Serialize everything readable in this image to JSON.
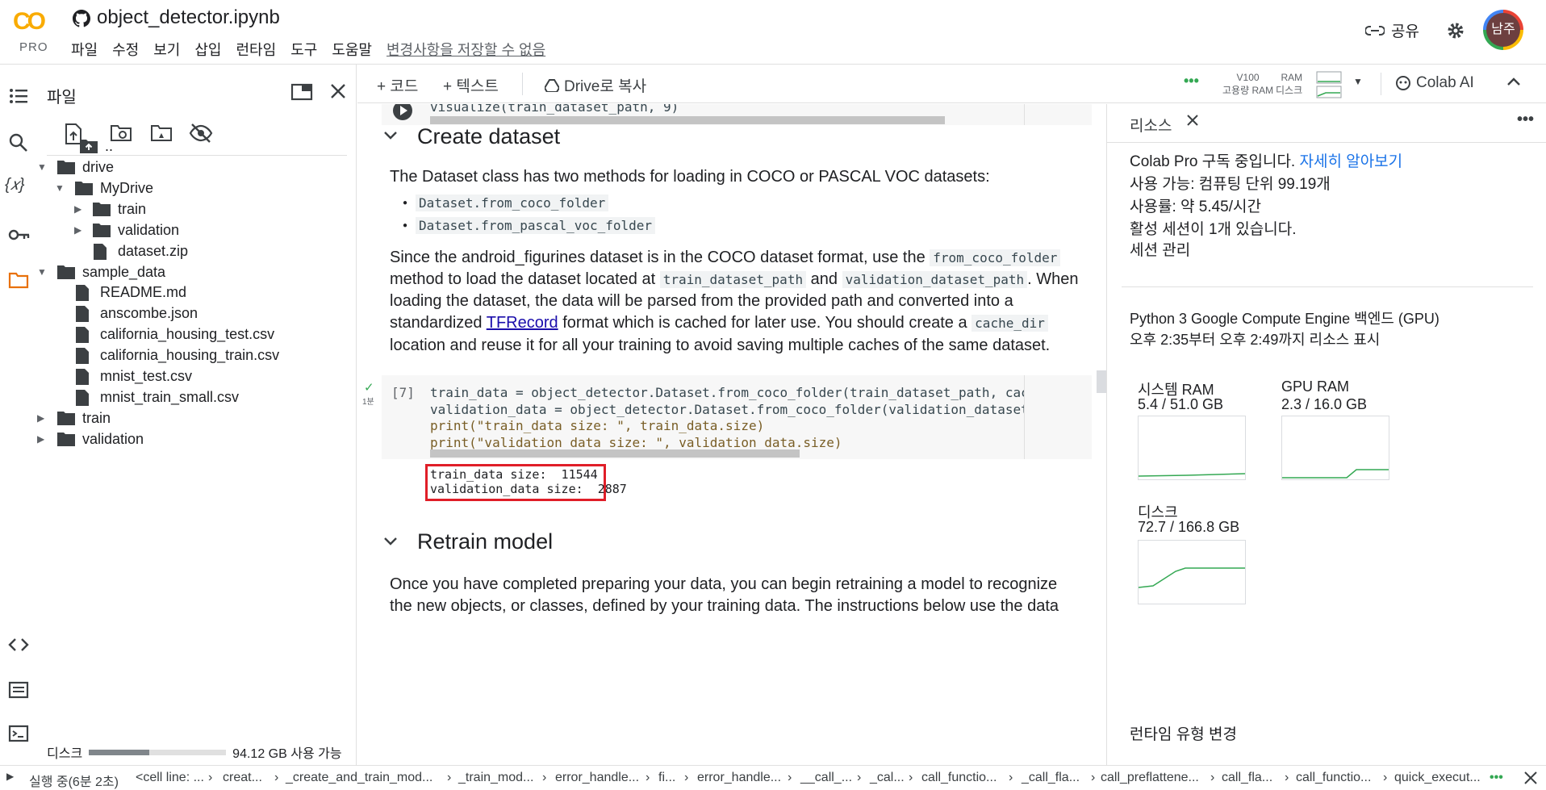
{
  "header": {
    "logo_text": "CO",
    "logo_sub": "PRO",
    "notebook_title": "object_detector.ipynb",
    "menu": [
      "파일",
      "수정",
      "보기",
      "삽입",
      "런타임",
      "도구",
      "도움말"
    ],
    "unsaved_notice": "변경사항을 저장할 수 없음",
    "share_label": "공유",
    "avatar_text": "남주"
  },
  "sidebar": {
    "title": "파일",
    "tree": [
      {
        "label": "..",
        "type": "up"
      },
      {
        "label": "drive",
        "type": "folder"
      },
      {
        "label": "MyDrive",
        "type": "folder"
      },
      {
        "label": "train",
        "type": "folder"
      },
      {
        "label": "validation",
        "type": "folder"
      },
      {
        "label": "dataset.zip",
        "type": "file"
      },
      {
        "label": "sample_data",
        "type": "folder"
      },
      {
        "label": "README.md",
        "type": "file"
      },
      {
        "label": "anscombe.json",
        "type": "file"
      },
      {
        "label": "california_housing_test.csv",
        "type": "file"
      },
      {
        "label": "california_housing_train.csv",
        "type": "file"
      },
      {
        "label": "mnist_test.csv",
        "type": "file"
      },
      {
        "label": "mnist_train_small.csv",
        "type": "file"
      },
      {
        "label": "train",
        "type": "folder"
      },
      {
        "label": "validation",
        "type": "folder"
      }
    ],
    "disk_label": "디스크",
    "disk_usage_text": "94.12 GB 사용 가능",
    "disk_used_fraction": 0.44
  },
  "toolbar": {
    "add_code": "+ 코드",
    "add_text": "+ 텍스트",
    "copy_drive": "Drive로 복사",
    "gpu_label": "V100",
    "gpu_sub": "고용량 RAM",
    "ram_label": "RAM",
    "disk_label": "디스크",
    "colab_ai": "Colab AI"
  },
  "notebook": {
    "top_code": "visualize(train_dataset_path, 9)",
    "section1_title": "Create dataset",
    "p1": "The Dataset class has two methods for loading in COCO or PASCAL VOC datasets:",
    "bullet1": "Dataset.from_coco_folder",
    "bullet2": "Dataset.from_pascal_voc_folder",
    "p2_a": "Since the android_figurines dataset is in the COCO dataset format, use the",
    "p2_code1": "from_coco_folder",
    "p2_b": "method to load the dataset located at",
    "p2_code2": "train_dataset_path",
    "p2_and": "and",
    "p2_code3": "validation_dataset_path",
    "p2_c": ". When",
    "p2_line3": "loading the dataset, the data will be parsed from the provided path and converted into a",
    "p2_d": "standardized",
    "p2_link": "TFRecord",
    "p2_e": "format which is cached for later use. You should create a",
    "p2_code4": "cache_dir",
    "p2_line5": "location and reuse it for all your training to avoid saving multiple caches of the same dataset.",
    "cell_index": "[7]",
    "cell_time": "1분",
    "code_lines": [
      "train_data = object_detector.Dataset.from_coco_folder(train_dataset_path, cache_dir=\"/tmp",
      "validation_data = object_detector.Dataset.from_coco_folder(validation_dataset_path, cache",
      "print(\"train_data size: \", train_data.size)",
      "print(\"validation_data size: \", validation_data.size)"
    ],
    "output_lines": [
      "train_data size:  11544",
      "validation_data size:  2887"
    ],
    "section2_title": "Retrain model",
    "p3_line1": "Once you have completed preparing your data, you can begin retraining a model to recognize",
    "p3_line2": "the new objects, or classes, defined by your training data. The instructions below use the data"
  },
  "resources": {
    "tab_label": "리소스",
    "sub_line1": "Colab Pro 구독 중입니다.",
    "sub_link": "자세히 알아보기",
    "units": "사용 가능: 컴퓨팅 단위 99.19개",
    "rate": "사용률: 약 5.45/시간",
    "sessions": "활성 세션이 1개 있습니다.",
    "manage_sessions": "세션 관리",
    "backend": "Python 3 Google Compute Engine 백엔드 (GPU)",
    "time_range": "오후 2:35부터 오후 2:49까지 리소스 표시",
    "sys_ram_label": "시스템 RAM",
    "sys_ram_value": "5.4 / 51.0 GB",
    "gpu_ram_label": "GPU RAM",
    "gpu_ram_value": "2.3 / 16.0 GB",
    "disk_label": "디스크",
    "disk_value": "72.7 / 166.8 GB",
    "change_runtime": "런타임 유형 변경"
  },
  "footer": {
    "status": "실행 중(6분 2초)",
    "stack": [
      "<cell line: ...",
      "creat...",
      "_create_and_train_mod...",
      "_train_mod...",
      "error_handle...",
      "fi...",
      "error_handle...",
      "__call_...",
      "_cal...",
      "call_functio...",
      "_call_fla...",
      "call_preflattene...",
      "call_fla...",
      "call_functio...",
      "quick_execut..."
    ]
  },
  "colors": {
    "accent": "#1a73e8",
    "highlight_box": "#e01e28",
    "logo": "#f9ab00"
  }
}
